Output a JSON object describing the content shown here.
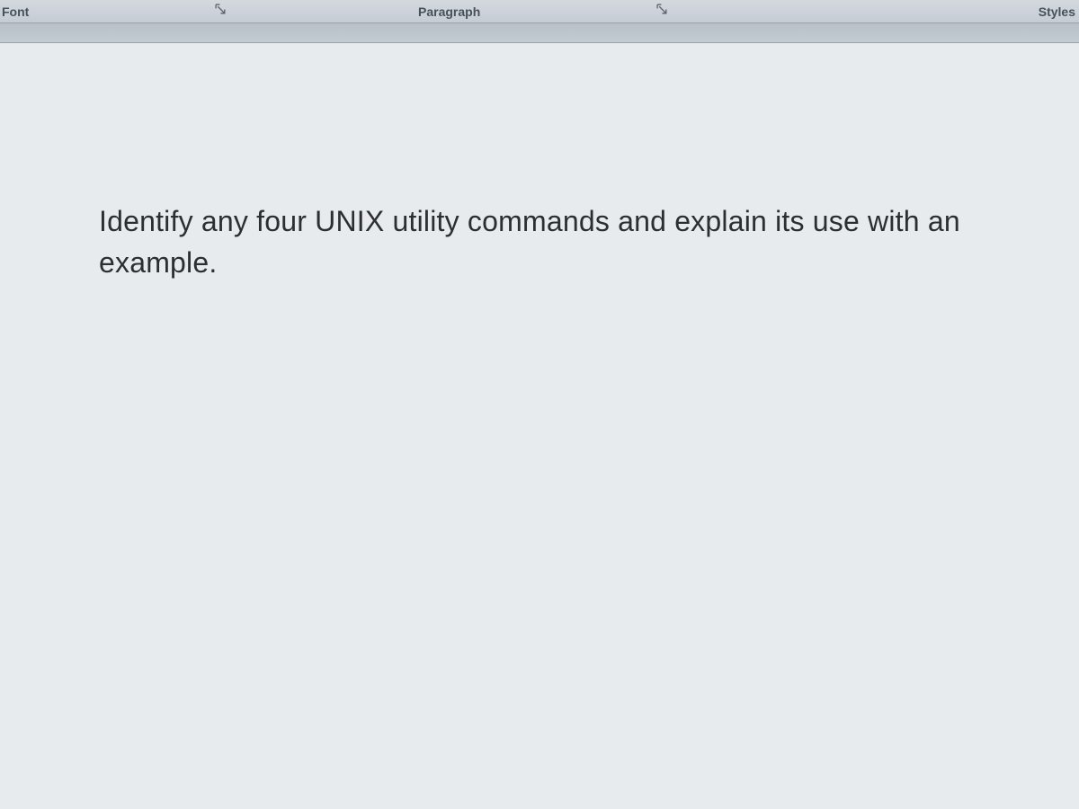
{
  "ribbon": {
    "groups": {
      "font": {
        "label": "Font"
      },
      "paragraph": {
        "label": "Paragraph"
      },
      "styles": {
        "label": "Styles"
      }
    }
  },
  "document": {
    "body_text": "Identify any four UNIX utility commands and explain its use with an example."
  }
}
